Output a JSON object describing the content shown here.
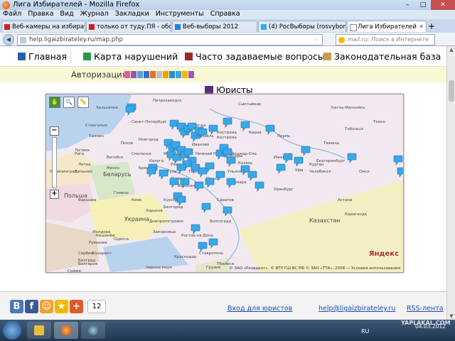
{
  "window": {
    "title": "Лига Избирателей - Mozilla Firefox",
    "controls": [
      "–",
      "□",
      "✕"
    ]
  },
  "menu": [
    "Файл",
    "Правка",
    "Вид",
    "Журнал",
    "Закладки",
    "Инструменты",
    "Справка"
  ],
  "tabs": [
    {
      "label": "Веб-камеры на избирате...",
      "icon_color": "#d02020"
    },
    {
      "label": "только от туду.ПЯ - обсу...",
      "icon_color": "#d02020"
    },
    {
      "label": "Веб-выборы 2012",
      "icon_color": "#2a7fd4"
    },
    {
      "label": "(4) РосВыборы (rosvybory...",
      "icon_color": "#33aaee"
    },
    {
      "label": "Лига Избирателей",
      "icon_color": "#ffffff"
    }
  ],
  "newtab_label": "+",
  "navbar": {
    "url": "help.ligaizbirateley.ru/map.php",
    "search_placeholder": "mail.ru: Поиск в Интернете",
    "back": "◀",
    "star": "☆"
  },
  "site_nav": [
    {
      "label": "Главная",
      "color": "#2a5faa"
    },
    {
      "label": "Карта нарушений",
      "color": "#2a9a4a"
    },
    {
      "label": "Часто задаваемые вопросы",
      "color": "#a02828"
    },
    {
      "label": "Законодательная база",
      "color": "#c8a050"
    }
  ],
  "auth": {
    "label": "Авторизация:",
    "icon_colors": [
      "#e85b9a",
      "#8a5cc4",
      "#5aa0e0",
      "#3b6cc0",
      "#e07030",
      "#c0c0c0",
      "#f0a000",
      "#2090d0",
      "#40a0e0",
      "#ffb000",
      "#9b59b6"
    ]
  },
  "lawyers": {
    "label": "Юристы",
    "color": "#5a2a7a"
  },
  "map": {
    "tools": [
      "✋",
      "🔍",
      "📏"
    ],
    "zoom_in": "+",
    "zoom_out": "−",
    "logo": "Яндекс",
    "copyright": "© ЗАО «Резидент», © ВТУ ГШ ВС РФ © ЗАО «ТТА», 2008 — Условия использования",
    "cities": [
      "Петрозаводск",
      "Хельсинки",
      "Стокгольм",
      "Санкт-Петербург",
      "Таллин",
      "Новгород",
      "Псков",
      "Рига",
      "Латвия",
      "Вологда",
      "Ярославль",
      "Кострома",
      "Кострома",
      "Иваново",
      "Сыктывкар",
      "Киров",
      "Пермь",
      "Екатеринбург",
      "Тюмень",
      "Ханты-Мансийск",
      "Тобольск",
      "Томск",
      "Омск",
      "Курган",
      "Челябинск",
      "Уфа",
      "Ижевск",
      "Казань",
      "Йошкар-Ола",
      "Нижний Новгород",
      "Чебоксары",
      "Самара",
      "Саратов",
      "Оренбург",
      "Ульяновск",
      "Пенза",
      "Тамбов",
      "Рязань",
      "Москва",
      "Калуга",
      "Тула",
      "Брянск",
      "Смоленск",
      "Витебск",
      "Минск",
      "Беларусь",
      "Гомель",
      "Литва",
      "Вильнюс",
      "Калининград",
      "Польша",
      "Варшава",
      "Киев",
      "Украина",
      "Харьков",
      "Днепропетровск",
      "Запорожье",
      "Одесса",
      "Молдова",
      "Кишинёв",
      "Румыния",
      "Бухарест",
      "Сербия",
      "Белград",
      "Болгария",
      "София",
      "Курск",
      "Белгород",
      "Воронеж",
      "Липецк",
      "Ростов-на-Дону",
      "Волгоград",
      "Краснодар",
      "Ставрополь",
      "Грузия",
      "Тбилиси",
      "Казахстан",
      "Астана",
      "Караганда",
      "Черное море"
    ],
    "markers": 58
  },
  "footer": {
    "share_count": "12",
    "share_icons": [
      {
        "t": "B",
        "c": "#4a78b8"
      },
      {
        "t": "f",
        "c": "#3b5998"
      },
      {
        "t": "☺",
        "c": "#f0a030"
      },
      {
        "t": "★",
        "c": "#f5b800"
      },
      {
        "t": "+",
        "c": "#e05a2a"
      }
    ],
    "links": [
      "Вход для юристов",
      "help@ligaizbirateley.ru",
      "RSS-лента"
    ]
  },
  "taskbar": {
    "lang": "RU",
    "time": "",
    "date": "04.03.2012",
    "watermark": "YAPLAKAL.COM"
  }
}
